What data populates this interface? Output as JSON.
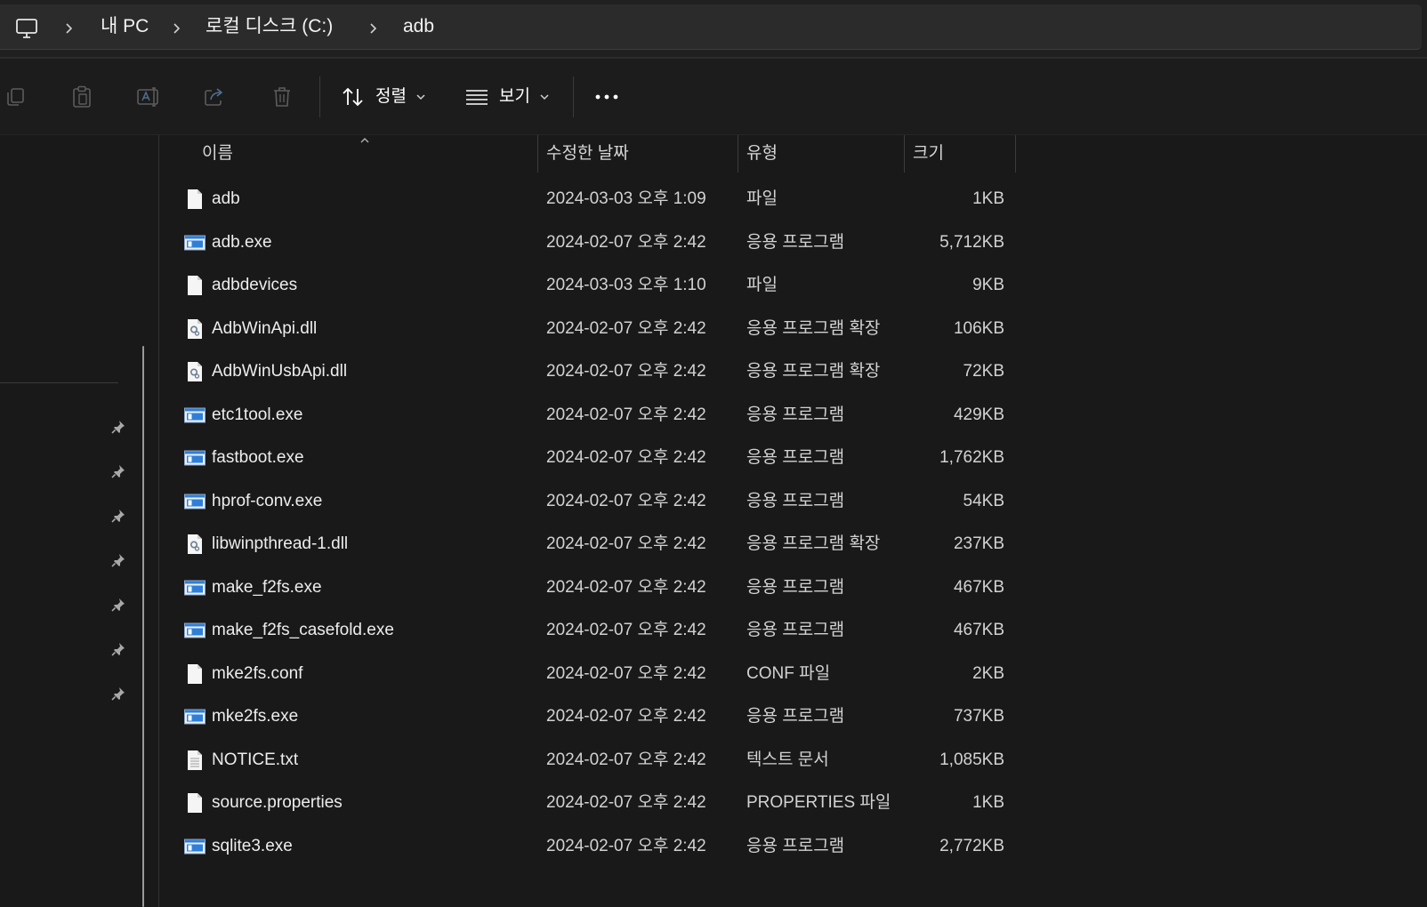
{
  "breadcrumb": {
    "root_icon": "pc-icon",
    "separator_icon": "chevron-right-icon",
    "items": [
      "내 PC",
      "로컬 디스크 (C:)",
      "adb"
    ]
  },
  "toolbar": {
    "actions": [
      {
        "icon": "copy-icon",
        "enabled": false
      },
      {
        "icon": "paste-icon",
        "enabled": false
      },
      {
        "icon": "rename-icon",
        "enabled": false
      },
      {
        "icon": "share-icon",
        "enabled": false
      },
      {
        "icon": "delete-icon",
        "enabled": false
      }
    ],
    "sort": {
      "icon": "sort-icon",
      "label": "정렬"
    },
    "view": {
      "icon": "view-list-icon",
      "label": "보기"
    },
    "more": {
      "icon": "more-icon"
    }
  },
  "navigation_pane": {
    "pins": [
      {
        "icon": "pin-icon"
      },
      {
        "icon": "pin-icon"
      },
      {
        "icon": "pin-icon"
      },
      {
        "icon": "pin-icon"
      },
      {
        "icon": "pin-icon"
      },
      {
        "icon": "pin-icon"
      },
      {
        "icon": "pin-icon"
      }
    ]
  },
  "header": {
    "name": "이름",
    "modified": "수정한 날짜",
    "type": "유형",
    "size": "크기",
    "sort_indicator_icon": "chevron-up-icon"
  },
  "files": [
    {
      "icon": "blank-file-icon",
      "name": "adb",
      "modified": "2024-03-03 오후 1:09",
      "type": "파일",
      "size": "1KB"
    },
    {
      "icon": "exe-icon",
      "name": "adb.exe",
      "modified": "2024-02-07 오후 2:42",
      "type": "응용 프로그램",
      "size": "5,712KB"
    },
    {
      "icon": "blank-file-icon",
      "name": "adbdevices",
      "modified": "2024-03-03 오후 1:10",
      "type": "파일",
      "size": "9KB"
    },
    {
      "icon": "dll-icon",
      "name": "AdbWinApi.dll",
      "modified": "2024-02-07 오후 2:42",
      "type": "응용 프로그램 확장",
      "size": "106KB"
    },
    {
      "icon": "dll-icon",
      "name": "AdbWinUsbApi.dll",
      "modified": "2024-02-07 오후 2:42",
      "type": "응용 프로그램 확장",
      "size": "72KB"
    },
    {
      "icon": "exe-icon",
      "name": "etc1tool.exe",
      "modified": "2024-02-07 오후 2:42",
      "type": "응용 프로그램",
      "size": "429KB"
    },
    {
      "icon": "exe-icon",
      "name": "fastboot.exe",
      "modified": "2024-02-07 오후 2:42",
      "type": "응용 프로그램",
      "size": "1,762KB"
    },
    {
      "icon": "exe-icon",
      "name": "hprof-conv.exe",
      "modified": "2024-02-07 오후 2:42",
      "type": "응용 프로그램",
      "size": "54KB"
    },
    {
      "icon": "dll-icon",
      "name": "libwinpthread-1.dll",
      "modified": "2024-02-07 오후 2:42",
      "type": "응용 프로그램 확장",
      "size": "237KB"
    },
    {
      "icon": "exe-icon",
      "name": "make_f2fs.exe",
      "modified": "2024-02-07 오후 2:42",
      "type": "응용 프로그램",
      "size": "467KB"
    },
    {
      "icon": "exe-icon",
      "name": "make_f2fs_casefold.exe",
      "modified": "2024-02-07 오후 2:42",
      "type": "응용 프로그램",
      "size": "467KB"
    },
    {
      "icon": "blank-file-icon",
      "name": "mke2fs.conf",
      "modified": "2024-02-07 오후 2:42",
      "type": "CONF 파일",
      "size": "2KB"
    },
    {
      "icon": "exe-icon",
      "name": "mke2fs.exe",
      "modified": "2024-02-07 오후 2:42",
      "type": "응용 프로그램",
      "size": "737KB"
    },
    {
      "icon": "text-file-icon",
      "name": "NOTICE.txt",
      "modified": "2024-02-07 오후 2:42",
      "type": "텍스트 문서",
      "size": "1,085KB"
    },
    {
      "icon": "blank-file-icon",
      "name": "source.properties",
      "modified": "2024-02-07 오후 2:42",
      "type": "PROPERTIES 파일",
      "size": "1KB"
    },
    {
      "icon": "exe-icon",
      "name": "sqlite3.exe",
      "modified": "2024-02-07 오후 2:42",
      "type": "응용 프로그램",
      "size": "2,772KB"
    }
  ],
  "colors": {
    "background": "#191919",
    "toolbar_background": "#1c1c1c",
    "address_bar_background": "#2b2b2b",
    "accent": "#2f7fd8",
    "disabled_icon": "#5c5c5c"
  }
}
